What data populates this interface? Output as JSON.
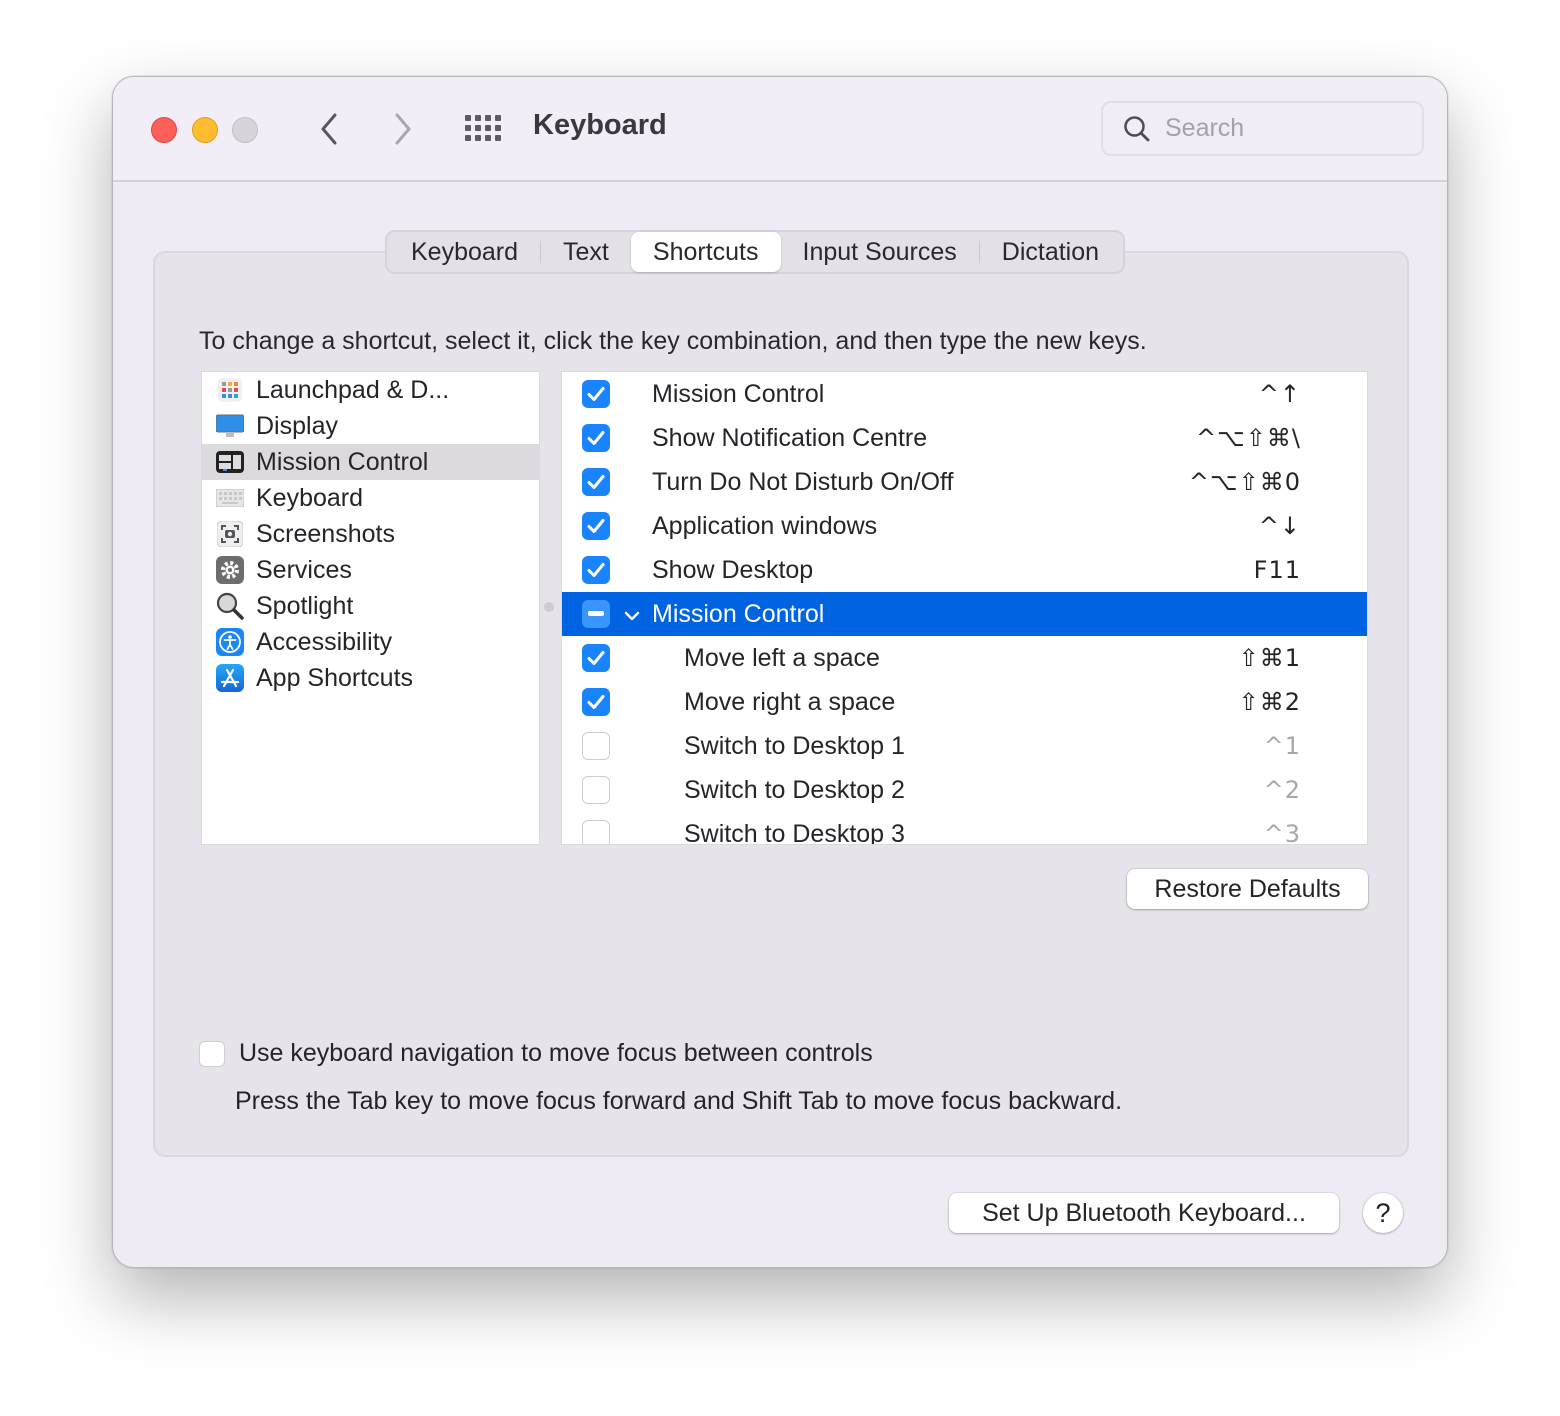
{
  "window": {
    "title": "Keyboard",
    "search": {
      "placeholder": "Search",
      "value": ""
    }
  },
  "tabs": [
    {
      "label": "Keyboard",
      "active": false
    },
    {
      "label": "Text",
      "active": false
    },
    {
      "label": "Shortcuts",
      "active": true
    },
    {
      "label": "Input Sources",
      "active": false
    },
    {
      "label": "Dictation",
      "active": false
    }
  ],
  "instructions": "To change a shortcut, select it, click the key combination, and then type the new keys.",
  "categories": [
    {
      "label": "Launchpad & D...",
      "icon": "launchpad-icon",
      "selected": false
    },
    {
      "label": "Display",
      "icon": "display-icon",
      "selected": false
    },
    {
      "label": "Mission Control",
      "icon": "mission-control-icon",
      "selected": true
    },
    {
      "label": "Keyboard",
      "icon": "keyboard-icon",
      "selected": false
    },
    {
      "label": "Screenshots",
      "icon": "screenshot-icon",
      "selected": false
    },
    {
      "label": "Services",
      "icon": "gear-icon",
      "selected": false
    },
    {
      "label": "Spotlight",
      "icon": "magnifier-icon",
      "selected": false
    },
    {
      "label": "Accessibility",
      "icon": "accessibility-icon",
      "selected": false
    },
    {
      "label": "App Shortcuts",
      "icon": "app-store-icon",
      "selected": false
    }
  ],
  "shortcuts": [
    {
      "label": "Mission Control",
      "keys": "^↑",
      "state": "checked",
      "level": 0
    },
    {
      "label": "Show Notification Centre",
      "keys": "^⌥⇧⌘\\",
      "state": "checked",
      "level": 0
    },
    {
      "label": "Turn Do Not Disturb On/Off",
      "keys": "^⌥⇧⌘0",
      "state": "checked",
      "level": 0
    },
    {
      "label": "Application windows",
      "keys": "^↓",
      "state": "checked",
      "level": 0
    },
    {
      "label": "Show Desktop",
      "keys": "F11",
      "state": "checked",
      "level": 0
    },
    {
      "label": "Mission Control",
      "keys": "",
      "state": "mixed",
      "level": 0,
      "group": true,
      "expanded": true,
      "selected": true
    },
    {
      "label": "Move left a space",
      "keys": "⇧⌘1",
      "state": "checked",
      "level": 1
    },
    {
      "label": "Move right a space",
      "keys": "⇧⌘2",
      "state": "checked",
      "level": 1
    },
    {
      "label": "Switch to Desktop 1",
      "keys": "^1",
      "state": "unchecked",
      "level": 1
    },
    {
      "label": "Switch to Desktop 2",
      "keys": "^2",
      "state": "unchecked",
      "level": 1
    },
    {
      "label": "Switch to Desktop 3",
      "keys": "^3",
      "state": "unchecked",
      "level": 1
    }
  ],
  "buttons": {
    "restore_defaults": "Restore Defaults",
    "bluetooth": "Set Up Bluetooth Keyboard...",
    "help": "?"
  },
  "keyboard_navigation": {
    "label": "Use keyboard navigation to move focus between controls",
    "checked": false,
    "hint": "Press the Tab key to move focus forward and Shift Tab to move focus backward."
  },
  "colors": {
    "accent": "#0063e1",
    "checkbox": "#1a84ff",
    "close": "#fe5f57",
    "minimize": "#febc2e"
  }
}
